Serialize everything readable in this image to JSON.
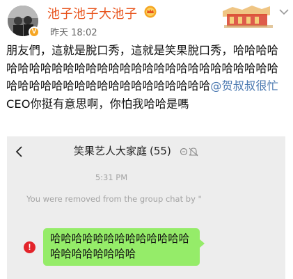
{
  "post": {
    "username": "池子池子大池子",
    "timestamp": "昨天 18:02",
    "verified_badge": "V",
    "text_before_mention": "朋友們，這就是脫口秀，這就是笑果脫口秀，哈哈哈哈哈哈哈哈哈哈哈哈哈哈哈哈哈哈哈哈哈哈哈哈哈哈哈哈哈哈哈哈哈哈哈哈哈哈哈哈哈哈哈哈哈哈",
    "mention": "@贺叔叔很忙",
    "text_after_mention": " CEO你挺有意思啊，你怕我哈哈是嗎"
  },
  "chat": {
    "group_name": "笑果艺人大家庭",
    "member_count": "(55)",
    "time": "5:31 PM",
    "system_message": "You were removed from the group chat by \"",
    "message": "哈哈哈哈哈哈哈哈哈哈哈哈哈哈哈哈哈哈哈哈哈",
    "error_mark": "!"
  },
  "icons": {
    "chevron": "chevron-down-icon",
    "back": "back-arrow-icon",
    "vip": "vip-crown-icon",
    "mute": "mute-bell-icon",
    "error": "error-icon"
  },
  "colors": {
    "username": "#e8541d",
    "mention": "#4a78b0",
    "bubble": "#95ec69",
    "error": "#e3242b",
    "chat_background": "#ededed"
  }
}
